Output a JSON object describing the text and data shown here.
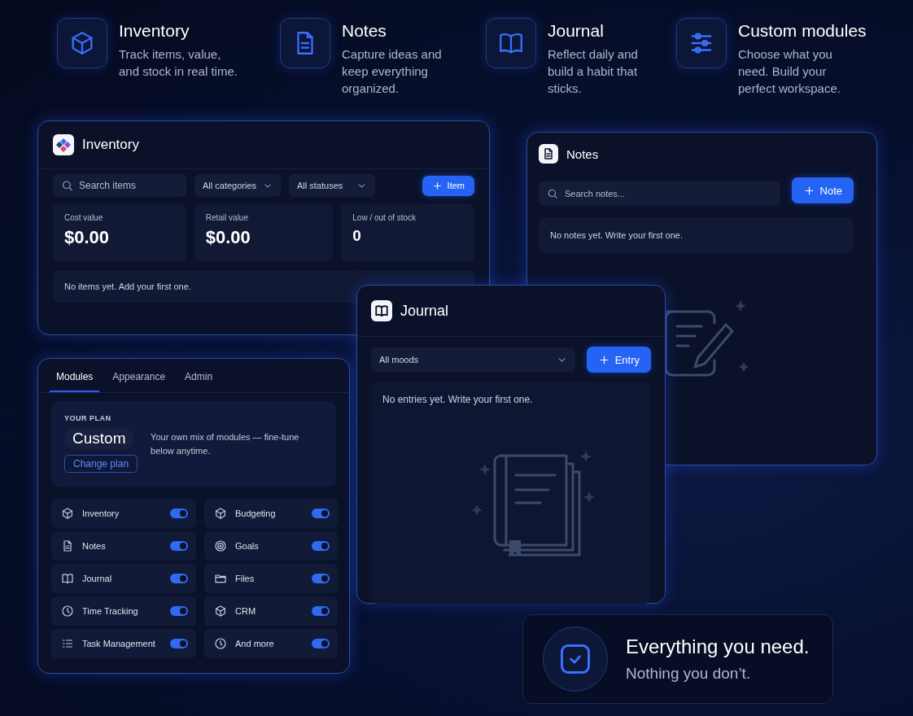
{
  "features": [
    {
      "kind": "cube",
      "title": "Inventory",
      "description": "Track items, value, and stock in real time."
    },
    {
      "kind": "doc",
      "title": "Notes",
      "description": "Capture ideas and keep everything organized."
    },
    {
      "kind": "book",
      "title": "Journal",
      "description": "Reflect daily and build a habit that sticks."
    },
    {
      "kind": "sliders",
      "title": "Custom modules",
      "description": "Choose what you need. Build your perfect workspace."
    }
  ],
  "inventory": {
    "title": "Inventory",
    "search": {
      "placeholder": "Search items"
    },
    "filters": [
      "All categories",
      "All statuses"
    ],
    "add_button": "Item",
    "stats": [
      {
        "label": "Cost value",
        "value": "$0.00"
      },
      {
        "label": "Retail value",
        "value": "$0.00"
      },
      {
        "label": "Low / out of stock",
        "value": "0"
      }
    ],
    "empty": "No items yet. Add your first one."
  },
  "notes": {
    "title": "Notes",
    "search": {
      "placeholder": "Search notes..."
    },
    "add_button": "Note",
    "empty": "No notes yet. Write your first one."
  },
  "journal": {
    "title": "Journal",
    "filter": "All moods",
    "add_button": "Entry",
    "empty": "No entries yet. Write your first one."
  },
  "settings": {
    "tabs": [
      {
        "label": "Modules",
        "selected": true
      },
      {
        "label": "Appearance",
        "selected": false
      },
      {
        "label": "Admin",
        "selected": false
      }
    ],
    "plan": {
      "eyebrow": "YOUR PLAN",
      "name": "Custom",
      "description": "Your own mix of modules — fine-tune below anytime.",
      "button": "Change plan"
    },
    "modules": [
      {
        "kind": "cube",
        "label": "Inventory",
        "on": true
      },
      {
        "kind": "doc",
        "label": "Notes",
        "on": true
      },
      {
        "kind": "book",
        "label": "Journal",
        "on": true
      },
      {
        "kind": "clock",
        "label": "Time Tracking",
        "on": true
      },
      {
        "kind": "list",
        "label": "Task Management",
        "on": true
      },
      {
        "kind": "cube",
        "label": "Budgeting",
        "on": true
      },
      {
        "kind": "target",
        "label": "Goals",
        "on": true
      },
      {
        "kind": "folder",
        "label": "Files",
        "on": true
      },
      {
        "kind": "cube",
        "label": "CRM",
        "on": true
      },
      {
        "kind": "clock",
        "label": "And more",
        "on": true
      }
    ]
  },
  "tagline": {
    "title": "Everything you need.",
    "subtitle": "Nothing you don’t."
  }
}
